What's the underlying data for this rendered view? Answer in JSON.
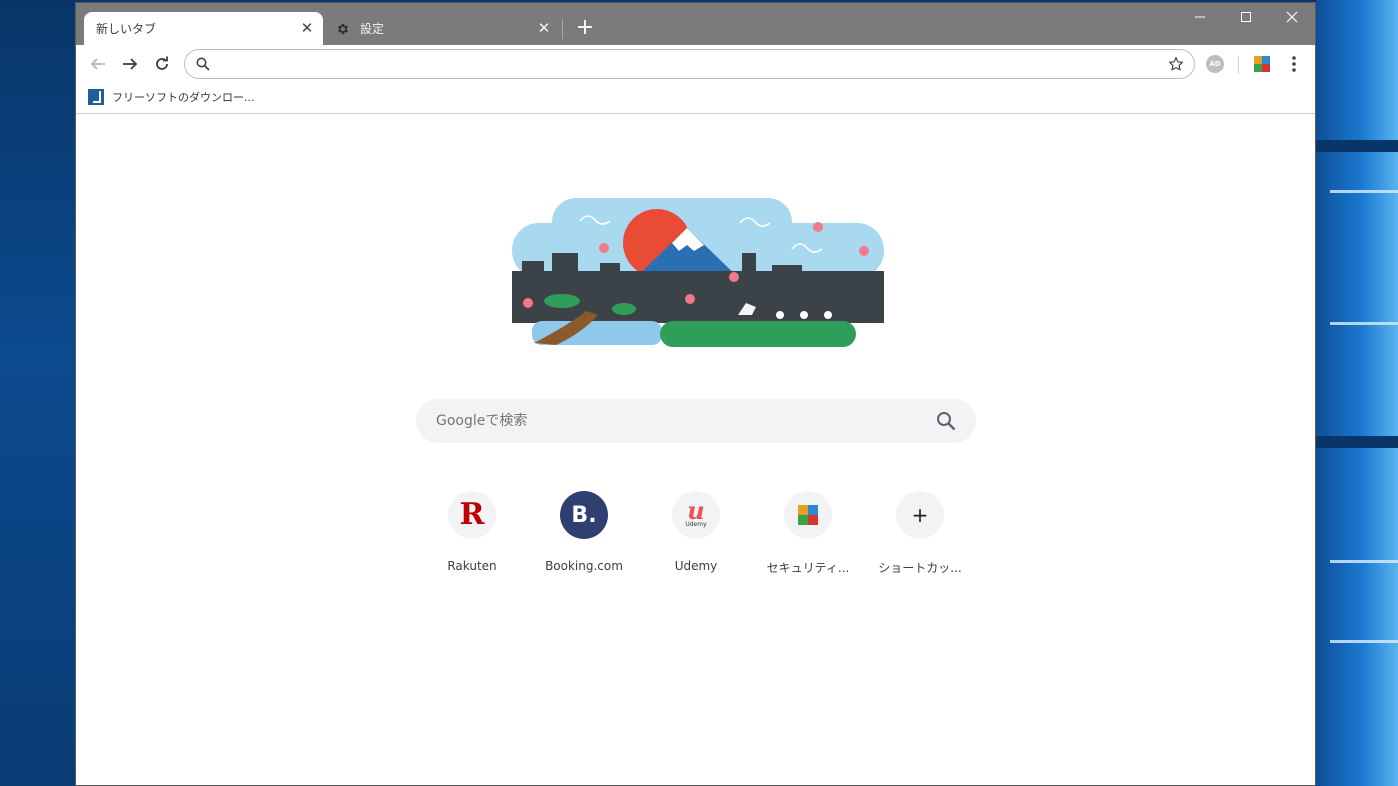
{
  "tabs": [
    {
      "label": "新しいタブ",
      "active": true
    },
    {
      "label": "設定",
      "active": false
    }
  ],
  "address": {
    "value": "",
    "placeholder": ""
  },
  "extensions": {
    "adblock_label": "AD"
  },
  "bookmarks": [
    {
      "label": "フリーソフトのダウンロー..."
    }
  ],
  "search": {
    "placeholder": "Googleで検索"
  },
  "shortcuts": [
    {
      "label": "Rakuten",
      "icon": "rakuten-icon",
      "glyph": "R",
      "color": "#bf0000"
    },
    {
      "label": "Booking.com",
      "icon": "booking-icon",
      "glyph": "B.",
      "color": "#2f3f6f"
    },
    {
      "label": "Udemy",
      "icon": "udemy-icon",
      "glyph": "u",
      "sub": "Udemy",
      "color": "#ec5252"
    },
    {
      "label": "セキュリティ...",
      "icon": "avg-security-icon",
      "glyph": "",
      "color": "#e8a020"
    },
    {
      "label": "ショートカッ...",
      "icon": "add-shortcut-icon",
      "glyph": "+",
      "color": "#202124"
    }
  ],
  "colors": {
    "titlebar": "#7b7b7b",
    "search_bg": "#f1f3f4"
  }
}
